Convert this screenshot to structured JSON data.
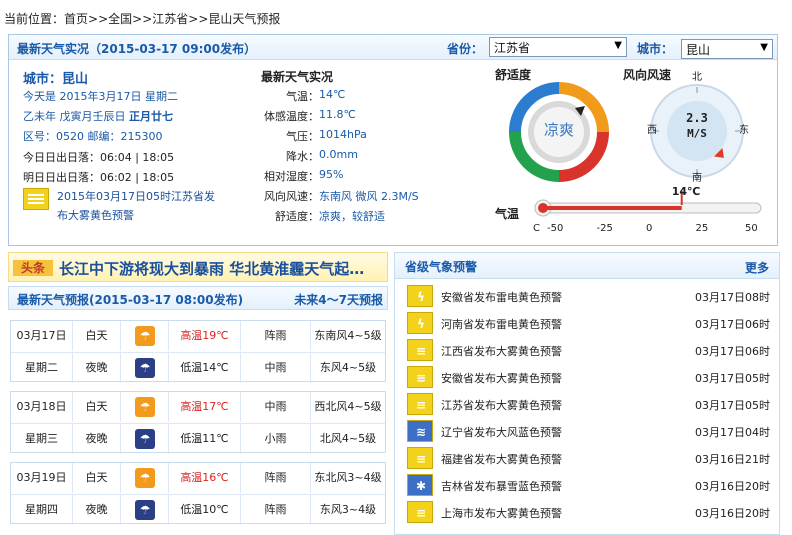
{
  "breadcrumb": {
    "prefix": "当前位置：",
    "items": [
      "首页",
      "全国",
      "江苏省",
      "昆山天气预报"
    ],
    "sep": ">>"
  },
  "current": {
    "header_title": "最新天气实况（2015-03-17 09:00发布）",
    "province_label": "省份：",
    "province_value": "江苏省",
    "city_label": "城市：",
    "city_value": "昆山",
    "city_title": "城市：昆山",
    "today_line": "今天是 2015年3月17日 星期二",
    "lunar_prefix": "乙未年 戊寅月壬辰日 ",
    "lunar_bold": "正月廿七",
    "zip_line": "区号：0520 邮编：215300",
    "sun_today": "今日日出日落：06:04 | 18:05",
    "sun_tomorrow": "明日日出日落：06:02 | 18:05",
    "warning_link": "2015年03月17日05时江苏省发布大雾黄色预警",
    "obs_title": "最新天气实况",
    "obs": [
      {
        "label": "气温：",
        "value": "14℃"
      },
      {
        "label": "体感温度：",
        "value": "11.8℃"
      },
      {
        "label": "气压：",
        "value": "1014hPa"
      },
      {
        "label": "降水：",
        "value": "0.0mm"
      },
      {
        "label": "相对湿度：",
        "value": "95%"
      },
      {
        "label": "风向风速：",
        "value": "东南风 微风 2.3M/S"
      },
      {
        "label": "舒适度：",
        "value": "凉爽，较舒适"
      }
    ],
    "comfort_title": "舒适度",
    "comfort_value": "凉爽",
    "wind_title": "风向风速",
    "wind_speed": "2.3",
    "wind_unit": "M/S",
    "wind_direction_degrees": 135,
    "compass": {
      "n": "北",
      "s": "南",
      "e": "东",
      "w": "西"
    },
    "temp_label": "气温",
    "temp_value": "14℃",
    "temp_number": 14,
    "temp_scale": {
      "unit": "C",
      "ticks": [
        "-50",
        "-25",
        "0",
        "25",
        "50"
      ],
      "min": -50,
      "max": 50
    }
  },
  "headline": {
    "tag": "头条",
    "text": "长江中下游将现大到暴雨 华北黄淮霾天气起…"
  },
  "forecast": {
    "title": "最新天气预报(2015-03-17 08:00发布)",
    "more": "未来4～7天预报",
    "days": [
      {
        "date": "03月17日",
        "week": "星期二",
        "day": {
          "period": "白天",
          "temp": "高温19℃",
          "weather": "阵雨",
          "wind": "东南风4~5级",
          "icon": "shower-icon"
        },
        "night": {
          "period": "夜晚",
          "temp": "低温14℃",
          "weather": "中雨",
          "wind": "东风4~5级",
          "icon": "rain-icon"
        }
      },
      {
        "date": "03月18日",
        "week": "星期三",
        "day": {
          "period": "白天",
          "temp": "高温17℃",
          "weather": "中雨",
          "wind": "西北风4~5级",
          "icon": "rain-icon"
        },
        "night": {
          "period": "夜晚",
          "temp": "低温11℃",
          "weather": "小雨",
          "wind": "北风4~5级",
          "icon": "rain-icon"
        }
      },
      {
        "date": "03月19日",
        "week": "星期四",
        "day": {
          "period": "白天",
          "temp": "高温16℃",
          "weather": "阵雨",
          "wind": "东北风3~4级",
          "icon": "shower-icon"
        },
        "night": {
          "period": "夜晚",
          "temp": "低温10℃",
          "weather": "阵雨",
          "wind": "东风3~4级",
          "icon": "shower-icon"
        }
      }
    ]
  },
  "warnings": {
    "title": "省级气象预警",
    "more": "更多",
    "items": [
      {
        "text": "安徽省发布雷电黄色预警",
        "time": "03月17日08时",
        "icon": "lightning-warning-icon",
        "color": "#f3d21b"
      },
      {
        "text": "河南省发布雷电黄色预警",
        "time": "03月17日06时",
        "icon": "lightning-warning-icon",
        "color": "#f3d21b"
      },
      {
        "text": "江西省发布大雾黄色预警",
        "time": "03月17日06时",
        "icon": "fog-warning-icon",
        "color": "#f3d21b"
      },
      {
        "text": "安徽省发布大雾黄色预警",
        "time": "03月17日05时",
        "icon": "fog-warning-icon",
        "color": "#f3d21b"
      },
      {
        "text": "江苏省发布大雾黄色预警",
        "time": "03月17日05时",
        "icon": "fog-warning-icon",
        "color": "#f3d21b"
      },
      {
        "text": "辽宁省发布大风蓝色预警",
        "time": "03月17日04时",
        "icon": "wind-warning-icon",
        "color": "#3d6fc7"
      },
      {
        "text": "福建省发布大雾黄色预警",
        "time": "03月16日21时",
        "icon": "fog-warning-icon",
        "color": "#f3d21b"
      },
      {
        "text": "吉林省发布暴雪蓝色预警",
        "time": "03月16日20时",
        "icon": "snow-warning-icon",
        "color": "#3d6fc7"
      },
      {
        "text": "上海市发布大雾黄色预警",
        "time": "03月16日20时",
        "icon": "fog-warning-icon",
        "color": "#f3d21b"
      }
    ]
  }
}
